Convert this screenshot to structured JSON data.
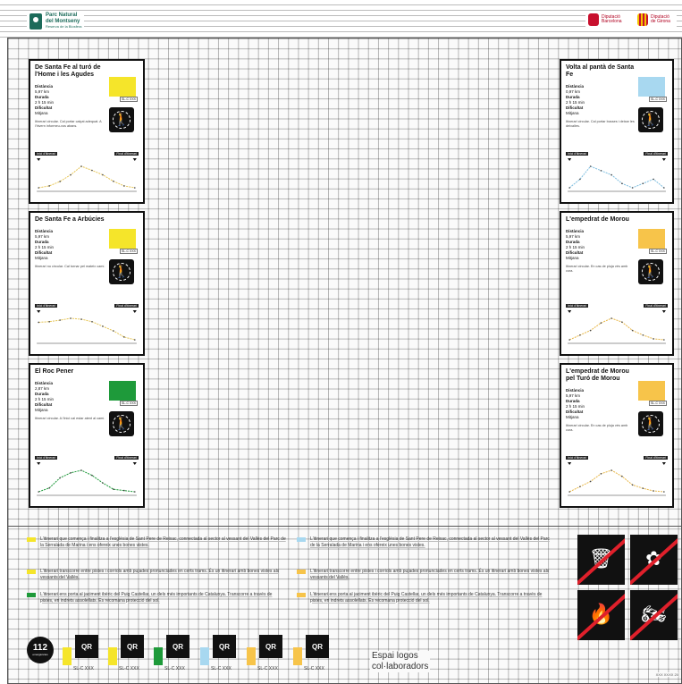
{
  "header": {
    "park_name_1": "Parc Natural",
    "park_name_2": "del Montseny",
    "park_sub": "Reserva de la Biosfera",
    "logo1": "Diputació Barcelona",
    "logo2": "Diputació de Girona"
  },
  "cards": [
    {
      "title": "De Santa Fe al turó de l'Home i les Agudes",
      "color": "#f5e52a",
      "km_tag": "SL-C XXX",
      "distance_label": "Distància",
      "distance": "5,97 km",
      "duration_label": "Durada",
      "duration": "2 h 15 min",
      "difficulty_label": "Dificultat",
      "difficulty": "Mitjana",
      "note": "Itinerari circular. Cal portar calçat adequat. A l'hivern informeu-vos abans.",
      "start_label": "Inici d'itinerari",
      "end_label": "Final d'itinerari",
      "profile_color": "#e7c75a",
      "elevation": [
        1130,
        1180,
        1300,
        1480,
        1710,
        1600,
        1480,
        1306,
        1180,
        1130
      ]
    },
    {
      "title": "De Santa Fe a Arbúcies",
      "color": "#f5e52a",
      "km_tag": "SL-C XXX",
      "distance_label": "Distància",
      "distance": "5,97 km",
      "duration_label": "Durada",
      "duration": "2 h 15 min",
      "difficulty_label": "Dificultat",
      "difficulty": "Mitjana",
      "note": "Itinerari no circular. Cal tornar pel mateix camí.",
      "start_label": "Inici d'itinerari",
      "end_label": "Final d'itinerari",
      "profile_color": "#e7c75a",
      "elevation": [
        1130,
        1150,
        1200,
        1260,
        1230,
        1150,
        1000,
        850,
        650,
        560
      ]
    },
    {
      "title": "El Roc Pener",
      "color": "#1e9a3a",
      "km_tag": "SL-C XXX",
      "distance_label": "Distància",
      "distance": "2,87 km",
      "duration_label": "Durada",
      "duration": "2 h 15 min",
      "difficulty_label": "Dificultat",
      "difficulty": "Mitjana",
      "note": "Itinerari circular. A l'inici cal estar atent al camí.",
      "start_label": "Inici d'itinerari",
      "end_label": "Final d'itinerari",
      "profile_color": "#1e9a3a",
      "elevation": [
        1130,
        1160,
        1240,
        1280,
        1300,
        1260,
        1200,
        1150,
        1140,
        1130
      ]
    },
    {
      "title": "Volta al pantà de Santa Fe",
      "color": "#a8d8f0",
      "km_tag": "SL-C XXX",
      "distance_label": "Distància",
      "distance": "0,97 km",
      "duration_label": "Durada",
      "duration": "2 h 15 min",
      "difficulty_label": "Dificultat",
      "difficulty": "Mitjana",
      "note": "Itinerari circular. Cal portar bosses i deixar les deixalles.",
      "start_label": "Inici d'itinerari",
      "end_label": "Final d'itinerari",
      "profile_color": "#7fbfe0",
      "elevation": [
        1130,
        1132,
        1135,
        1134,
        1133,
        1131,
        1130,
        1131,
        1132,
        1130
      ]
    },
    {
      "title": "L'empedrat de Morou",
      "color": "#f7c44a",
      "km_tag": "SL-C XXX",
      "distance_label": "Distància",
      "distance": "5,97 km",
      "duration_label": "Durada",
      "duration": "2 h 15 min",
      "difficulty_label": "Dificultat",
      "difficulty": "Mitjana",
      "note": "Itinerari circular. En cas de pluja vés amb cura.",
      "start_label": "Inici d'itinerari",
      "end_label": "Final d'itinerari",
      "profile_color": "#e8b84a",
      "elevation": [
        1000,
        1050,
        1100,
        1180,
        1230,
        1190,
        1100,
        1050,
        1010,
        1000
      ]
    },
    {
      "title": "L'empedrat de Morou pel Turó de Morou",
      "color": "#f7c44a",
      "km_tag": "SL-C XXX",
      "distance_label": "Distància",
      "distance": "5,97 km",
      "duration_label": "Durada",
      "duration": "2 h 15 min",
      "difficulty_label": "Dificultat",
      "difficulty": "Mitjana",
      "note": "Itinerari circular. En cas de pluja vés amb cura.",
      "start_label": "Inici d'itinerari",
      "end_label": "Final d'itinerari",
      "profile_color": "#e8b84a",
      "elevation": [
        1000,
        1060,
        1120,
        1210,
        1250,
        1180,
        1080,
        1040,
        1010,
        1000
      ]
    }
  ],
  "legend": [
    {
      "color": "#f5e52a",
      "text": "L'itinerari que comença i finalitza a l'església de Sant Pere de Reixac, connectada al sector al vessant del Vallès del Parc de la Serralada de Marina i ens ofereix unes bones vistes."
    },
    {
      "color": "#f5e52a",
      "text": "L'itinerari transcorre entre pistes i corriols amb pujades pronunciades en certs trams. És un itinerari amb bones vistes als vessants del Vallès."
    },
    {
      "color": "#1e9a3a",
      "text": "L'itinerari ens porta al jaciment ibèric del Puig Castellar, un dels més importants de Catalunya. Transcorre a través de pistes, en indrets assolellats. Es recomana protecció del sol."
    },
    {
      "color": "#a8d8f0",
      "text": "L'itinerari que comença i finalitza a l'església de Sant Pere de Reixac, connectada al sector al vessant del Vallès del Parc de la Serralada de Marina i ens ofereix unes bones vistes."
    },
    {
      "color": "#f7c44a",
      "text": "L'itinerari transcorre entre pistes i corriols amb pujades pronunciades en certs trams. És un itinerari amb bones vistes als vessants del Vallès."
    },
    {
      "color": "#f7c44a",
      "text": "L'itinerari ens porta al jaciment ibèric del Puig Castellar, un dels més importants de Catalunya. Transcorre a través de pistes, en indrets assolellats. Es recomana protecció del sol."
    }
  ],
  "emergency": {
    "number": "112",
    "sub": "emergències"
  },
  "qr_blocks": [
    {
      "color": "#f5e52a",
      "label": "QR",
      "caption": "SL-C XXX"
    },
    {
      "color": "#f5e52a",
      "label": "QR",
      "caption": "SL-C XXX"
    },
    {
      "color": "#1e9a3a",
      "label": "QR",
      "caption": "SL-C XXX"
    },
    {
      "color": "#a8d8f0",
      "label": "QR",
      "caption": "SL-C XXX"
    },
    {
      "color": "#f7c44a",
      "label": "QR",
      "caption": "SL-C XXX"
    },
    {
      "color": "#f7c44a",
      "label": "QR",
      "caption": "SL-C XXX"
    }
  ],
  "collab_1": "Espai logos",
  "collab_2": "col·laboradors",
  "code": "XXX XXXX 20",
  "prohibitions": [
    "no-litter-icon",
    "no-flower-picking-icon",
    "no-fire-icon",
    "no-motorbike-icon"
  ]
}
